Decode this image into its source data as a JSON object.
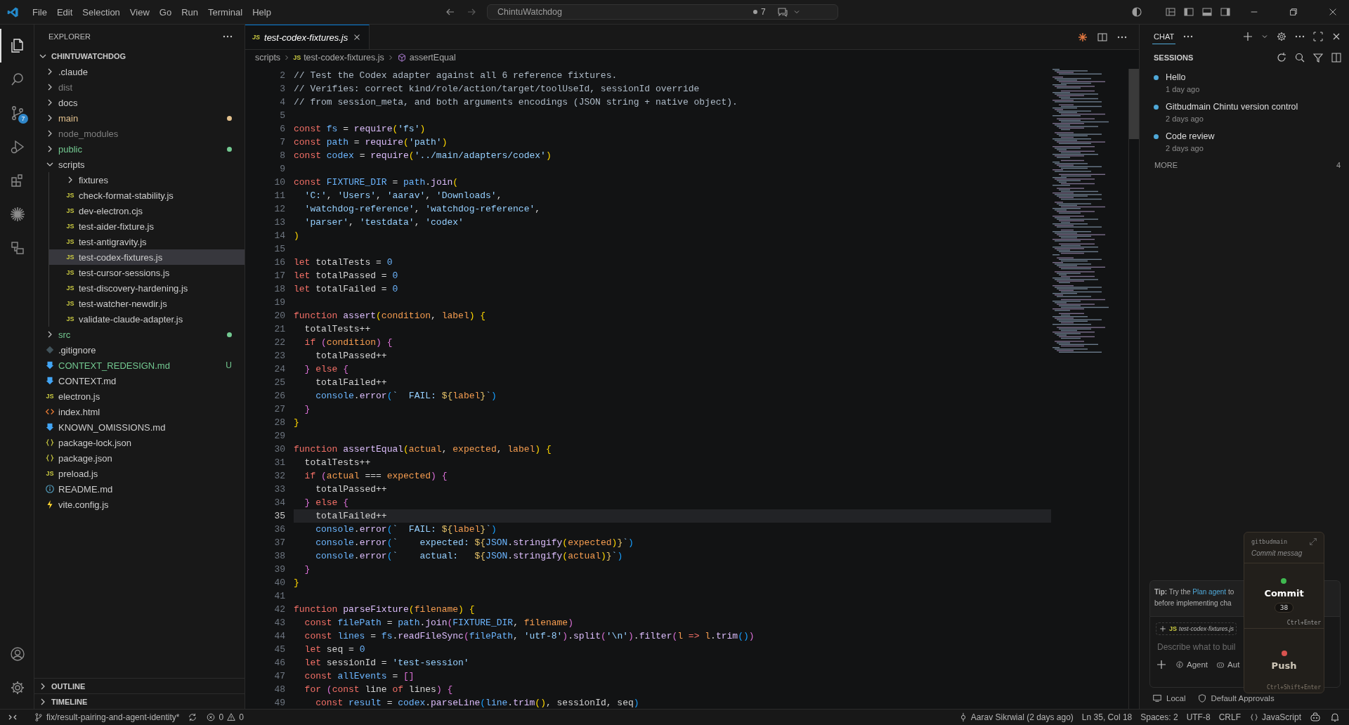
{
  "title_bar": {
    "menus": [
      "File",
      "Edit",
      "Selection",
      "View",
      "Go",
      "Run",
      "Terminal",
      "Help"
    ],
    "command_center": "ChintuWatchdog",
    "agent_count": "7"
  },
  "activity_bar": {
    "items": [
      {
        "kind": "files",
        "selected": true
      },
      {
        "kind": "search",
        "selected": false
      },
      {
        "kind": "source-control",
        "selected": false,
        "badge": "7"
      },
      {
        "kind": "run",
        "selected": false
      },
      {
        "kind": "extensions",
        "selected": false
      },
      {
        "kind": "burst",
        "selected": false
      },
      {
        "kind": "remote",
        "selected": false
      }
    ],
    "bottom": [
      {
        "kind": "account"
      },
      {
        "kind": "settings"
      }
    ]
  },
  "explorer": {
    "title": "EXPLORER",
    "root": "CHINTUWATCHDOG",
    "root_expanded": true,
    "items": [
      {
        "name": ".claude",
        "kind": "folder",
        "expanded": false,
        "selected": false
      },
      {
        "name": "dist",
        "kind": "folder",
        "expanded": false,
        "selected": false,
        "dimmed": true
      },
      {
        "name": "docs",
        "kind": "folder",
        "expanded": false,
        "selected": false
      },
      {
        "name": "main",
        "kind": "folder",
        "expanded": false,
        "selected": false,
        "color": "#e2c08d"
      },
      {
        "name": "node_modules",
        "kind": "folder",
        "expanded": false,
        "selected": false,
        "dimmed": true
      },
      {
        "name": "public",
        "kind": "folder",
        "expanded": false,
        "selected": false,
        "color": "#73c991"
      },
      {
        "name": "scripts",
        "kind": "folder",
        "expanded": true,
        "selected": false,
        "children": [
          {
            "name": "fixtures",
            "kind": "folder",
            "expanded": false,
            "selected": false
          },
          {
            "name": "check-format-stability.js",
            "kind": "js",
            "icon_label": "JS",
            "selected": false
          },
          {
            "name": "dev-electron.cjs",
            "kind": "js",
            "icon_label": "JS",
            "selected": false
          },
          {
            "name": "test-aider-fixture.js",
            "kind": "js",
            "icon_label": "JS",
            "selected": false
          },
          {
            "name": "test-antigravity.js",
            "kind": "js",
            "icon_label": "JS",
            "selected": false
          },
          {
            "name": "test-codex-fixtures.js",
            "kind": "js",
            "icon_label": "JS",
            "selected": true
          },
          {
            "name": "test-cursor-sessions.js",
            "kind": "js",
            "icon_label": "JS",
            "selected": false
          },
          {
            "name": "test-discovery-hardening.js",
            "kind": "js",
            "icon_label": "JS",
            "selected": false
          },
          {
            "name": "test-watcher-newdir.js",
            "kind": "js",
            "icon_label": "JS",
            "selected": false
          },
          {
            "name": "validate-claude-adapter.js",
            "kind": "js",
            "icon_label": "JS",
            "selected": false
          }
        ]
      },
      {
        "name": "src",
        "kind": "folder",
        "expanded": false,
        "selected": false,
        "color": "#73c991"
      },
      {
        "name": ".gitignore",
        "kind": "git",
        "selected": false
      },
      {
        "name": "CONTEXT_REDESIGN.md",
        "kind": "md",
        "selected": false,
        "color": "#73c991",
        "badge": "U"
      },
      {
        "name": "CONTEXT.md",
        "kind": "md",
        "selected": false
      },
      {
        "name": "electron.js",
        "kind": "js",
        "icon_label": "JS",
        "selected": false
      },
      {
        "name": "index.html",
        "kind": "html",
        "selected": false
      },
      {
        "name": "KNOWN_OMISSIONS.md",
        "kind": "md",
        "selected": false
      },
      {
        "name": "package-lock.json",
        "kind": "json",
        "selected": false
      },
      {
        "name": "package.json",
        "kind": "json",
        "selected": false
      },
      {
        "name": "preload.js",
        "kind": "js",
        "icon_label": "JS",
        "selected": false
      },
      {
        "name": "README.md",
        "kind": "info",
        "selected": false
      },
      {
        "name": "vite.config.js",
        "kind": "vite",
        "selected": false
      }
    ],
    "sections": [
      {
        "label": "OUTLINE",
        "expanded": false
      },
      {
        "label": "TIMELINE",
        "expanded": false
      }
    ]
  },
  "editor": {
    "tabs": [
      {
        "label": "test-codex-fixtures.js",
        "icon_label": "JS",
        "selected": true,
        "preview": true
      }
    ],
    "breadcrumbs": [
      {
        "text": "scripts"
      },
      {
        "text": "test-codex-fixtures.js",
        "icon_label": "JS"
      },
      {
        "text": "assertEqual",
        "kind": "symbol"
      }
    ],
    "lines": [
      {
        "number": "2",
        "current": false,
        "tokens": [
          {
            "kind": "cm",
            "text": "// Test the Codex adapter against all 6 reference fixtures."
          }
        ]
      },
      {
        "number": "3",
        "current": false,
        "tokens": [
          {
            "kind": "cm",
            "text": "// Verifies: correct kind/role/action/target/toolUseId, sessionId override"
          }
        ]
      },
      {
        "number": "4",
        "current": false,
        "tokens": [
          {
            "kind": "cm",
            "text": "// from session_meta, and both arguments encodings (JSON string + native object)."
          }
        ]
      },
      {
        "number": "5",
        "current": false
      },
      {
        "number": "6",
        "current": false,
        "tokens": [
          {
            "kind": "kw",
            "text": "const"
          },
          {
            "kind": "var",
            "text": " fs"
          },
          {
            "kind": "pl",
            "text": " = "
          },
          {
            "kind": "fn",
            "text": "require"
          },
          {
            "kind": "b1",
            "text": "("
          },
          {
            "kind": "str",
            "text": "'fs'"
          },
          {
            "kind": "b1",
            "text": ")"
          }
        ]
      },
      {
        "number": "7",
        "current": false,
        "tokens": [
          {
            "kind": "kw",
            "text": "const"
          },
          {
            "kind": "var",
            "text": " path"
          },
          {
            "kind": "pl",
            "text": " = "
          },
          {
            "kind": "fn",
            "text": "require"
          },
          {
            "kind": "b1",
            "text": "("
          },
          {
            "kind": "str",
            "text": "'path'"
          },
          {
            "kind": "b1",
            "text": ")"
          }
        ]
      },
      {
        "number": "8",
        "current": false,
        "tokens": [
          {
            "kind": "kw",
            "text": "const"
          },
          {
            "kind": "var",
            "text": " codex"
          },
          {
            "kind": "pl",
            "text": " = "
          },
          {
            "kind": "fn",
            "text": "require"
          },
          {
            "kind": "b1",
            "text": "("
          },
          {
            "kind": "str",
            "text": "'../main/adapters/codex'"
          },
          {
            "kind": "b1",
            "text": ")"
          }
        ]
      },
      {
        "number": "9",
        "current": false
      },
      {
        "number": "10",
        "current": false,
        "tokens": [
          {
            "kind": "kw",
            "text": "const"
          },
          {
            "kind": "var",
            "text": " FIXTURE_DIR"
          },
          {
            "kind": "pl",
            "text": " = "
          },
          {
            "kind": "var",
            "text": "path"
          },
          {
            "kind": "pl",
            "text": "."
          },
          {
            "kind": "fn",
            "text": "join"
          },
          {
            "kind": "b1",
            "text": "("
          }
        ]
      },
      {
        "number": "11",
        "current": false,
        "tokens": [
          {
            "kind": "str",
            "text": "  'C:'"
          },
          {
            "kind": "pl",
            "text": ", "
          },
          {
            "kind": "str",
            "text": "'Users'"
          },
          {
            "kind": "pl",
            "text": ", "
          },
          {
            "kind": "str",
            "text": "'aarav'"
          },
          {
            "kind": "pl",
            "text": ", "
          },
          {
            "kind": "str",
            "text": "'Downloads'"
          },
          {
            "kind": "pl",
            "text": ","
          }
        ]
      },
      {
        "number": "12",
        "current": false,
        "tokens": [
          {
            "kind": "str",
            "text": "  'watchdog-reference'"
          },
          {
            "kind": "pl",
            "text": ", "
          },
          {
            "kind": "str",
            "text": "'watchdog-reference'"
          },
          {
            "kind": "pl",
            "text": ","
          }
        ]
      },
      {
        "number": "13",
        "current": false,
        "tokens": [
          {
            "kind": "str",
            "text": "  'parser'"
          },
          {
            "kind": "pl",
            "text": ", "
          },
          {
            "kind": "str",
            "text": "'testdata'"
          },
          {
            "kind": "pl",
            "text": ", "
          },
          {
            "kind": "str",
            "text": "'codex'"
          }
        ]
      },
      {
        "number": "14",
        "current": false,
        "tokens": [
          {
            "kind": "b1",
            "text": ")"
          }
        ]
      },
      {
        "number": "15",
        "current": false
      },
      {
        "number": "16",
        "current": false,
        "tokens": [
          {
            "kind": "kw",
            "text": "let"
          },
          {
            "kind": "pl",
            "text": " totalTests = "
          },
          {
            "kind": "num",
            "text": "0"
          }
        ]
      },
      {
        "number": "17",
        "current": false,
        "tokens": [
          {
            "kind": "kw",
            "text": "let"
          },
          {
            "kind": "pl",
            "text": " totalPassed = "
          },
          {
            "kind": "num",
            "text": "0"
          }
        ]
      },
      {
        "number": "18",
        "current": false,
        "tokens": [
          {
            "kind": "kw",
            "text": "let"
          },
          {
            "kind": "pl",
            "text": " totalFailed = "
          },
          {
            "kind": "num",
            "text": "0"
          }
        ]
      },
      {
        "number": "19",
        "current": false
      },
      {
        "number": "20",
        "current": false,
        "tokens": [
          {
            "kind": "kw",
            "text": "function"
          },
          {
            "kind": "fn",
            "text": " assert"
          },
          {
            "kind": "b1",
            "text": "("
          },
          {
            "kind": "prm",
            "text": "condition"
          },
          {
            "kind": "pl",
            "text": ", "
          },
          {
            "kind": "prm",
            "text": "label"
          },
          {
            "kind": "b1",
            "text": ")"
          },
          {
            "kind": "b1",
            "text": " {"
          }
        ]
      },
      {
        "number": "21",
        "current": false,
        "tokens": [
          {
            "kind": "pl",
            "text": "  totalTests++"
          }
        ]
      },
      {
        "number": "22",
        "current": false,
        "tokens": [
          {
            "kind": "kw",
            "text": "  if"
          },
          {
            "kind": "b2",
            "text": " ("
          },
          {
            "kind": "prm",
            "text": "condition"
          },
          {
            "kind": "b2",
            "text": ")"
          },
          {
            "kind": "b2",
            "text": " {"
          }
        ]
      },
      {
        "number": "23",
        "current": false,
        "tokens": [
          {
            "kind": "pl",
            "text": "    totalPassed++"
          }
        ]
      },
      {
        "number": "24",
        "current": false,
        "tokens": [
          {
            "kind": "b2",
            "text": "  }"
          },
          {
            "kind": "kw",
            "text": " else"
          },
          {
            "kind": "b2",
            "text": " {"
          }
        ]
      },
      {
        "number": "25",
        "current": false,
        "tokens": [
          {
            "kind": "pl",
            "text": "    totalFailed++"
          }
        ]
      },
      {
        "number": "26",
        "current": false,
        "tokens": [
          {
            "kind": "var",
            "text": "    console"
          },
          {
            "kind": "pl",
            "text": "."
          },
          {
            "kind": "fn",
            "text": "error"
          },
          {
            "kind": "b3",
            "text": "("
          },
          {
            "kind": "str",
            "text": "`  FAIL: "
          },
          {
            "kind": "tpl",
            "text": "${"
          },
          {
            "kind": "prm",
            "text": "label"
          },
          {
            "kind": "tpl",
            "text": "}"
          },
          {
            "kind": "str",
            "text": "`"
          },
          {
            "kind": "b3",
            "text": ")"
          }
        ]
      },
      {
        "number": "27",
        "current": false,
        "tokens": [
          {
            "kind": "b2",
            "text": "  }"
          }
        ]
      },
      {
        "number": "28",
        "current": false,
        "tokens": [
          {
            "kind": "b1",
            "text": "}"
          }
        ]
      },
      {
        "number": "29",
        "current": false
      },
      {
        "number": "30",
        "current": false,
        "tokens": [
          {
            "kind": "kw",
            "text": "function"
          },
          {
            "kind": "fn",
            "text": " assertEqual"
          },
          {
            "kind": "b1",
            "text": "("
          },
          {
            "kind": "prm",
            "text": "actual"
          },
          {
            "kind": "pl",
            "text": ", "
          },
          {
            "kind": "prm",
            "text": "expected"
          },
          {
            "kind": "pl",
            "text": ", "
          },
          {
            "kind": "prm",
            "text": "label"
          },
          {
            "kind": "b1",
            "text": ")"
          },
          {
            "kind": "b1",
            "text": " {"
          }
        ]
      },
      {
        "number": "31",
        "current": false,
        "tokens": [
          {
            "kind": "pl",
            "text": "  totalTests++"
          }
        ]
      },
      {
        "number": "32",
        "current": false,
        "tokens": [
          {
            "kind": "kw",
            "text": "  if"
          },
          {
            "kind": "b2",
            "text": " ("
          },
          {
            "kind": "prm",
            "text": "actual"
          },
          {
            "kind": "pl",
            "text": " === "
          },
          {
            "kind": "prm",
            "text": "expected"
          },
          {
            "kind": "b2",
            "text": ")"
          },
          {
            "kind": "b2",
            "text": " {"
          }
        ]
      },
      {
        "number": "33",
        "current": false,
        "tokens": [
          {
            "kind": "pl",
            "text": "    totalPassed++"
          }
        ]
      },
      {
        "number": "34",
        "current": false,
        "tokens": [
          {
            "kind": "b2",
            "text": "  }"
          },
          {
            "kind": "kw",
            "text": " else"
          },
          {
            "kind": "b2",
            "text": " {"
          }
        ]
      },
      {
        "number": "35",
        "current": true,
        "tokens": [
          {
            "kind": "pl",
            "text": "    totalFailed++"
          }
        ]
      },
      {
        "number": "36",
        "current": false,
        "tokens": [
          {
            "kind": "var",
            "text": "    console"
          },
          {
            "kind": "pl",
            "text": "."
          },
          {
            "kind": "fn",
            "text": "error"
          },
          {
            "kind": "b3",
            "text": "("
          },
          {
            "kind": "str",
            "text": "`  FAIL: "
          },
          {
            "kind": "tpl",
            "text": "${"
          },
          {
            "kind": "prm",
            "text": "label"
          },
          {
            "kind": "tpl",
            "text": "}"
          },
          {
            "kind": "str",
            "text": "`"
          },
          {
            "kind": "b3",
            "text": ")"
          }
        ]
      },
      {
        "number": "37",
        "current": false,
        "tokens": [
          {
            "kind": "var",
            "text": "    console"
          },
          {
            "kind": "pl",
            "text": "."
          },
          {
            "kind": "fn",
            "text": "error"
          },
          {
            "kind": "b3",
            "text": "("
          },
          {
            "kind": "str",
            "text": "`    expected: "
          },
          {
            "kind": "tpl",
            "text": "${"
          },
          {
            "kind": "var",
            "text": "JSON"
          },
          {
            "kind": "pl",
            "text": "."
          },
          {
            "kind": "fn",
            "text": "stringify"
          },
          {
            "kind": "b1",
            "text": "("
          },
          {
            "kind": "prm",
            "text": "expected"
          },
          {
            "kind": "b1",
            "text": ")"
          },
          {
            "kind": "tpl",
            "text": "}"
          },
          {
            "kind": "str",
            "text": "`"
          },
          {
            "kind": "b3",
            "text": ")"
          }
        ]
      },
      {
        "number": "38",
        "current": false,
        "tokens": [
          {
            "kind": "var",
            "text": "    console"
          },
          {
            "kind": "pl",
            "text": "."
          },
          {
            "kind": "fn",
            "text": "error"
          },
          {
            "kind": "b3",
            "text": "("
          },
          {
            "kind": "str",
            "text": "`    actual:   "
          },
          {
            "kind": "tpl",
            "text": "${"
          },
          {
            "kind": "var",
            "text": "JSON"
          },
          {
            "kind": "pl",
            "text": "."
          },
          {
            "kind": "fn",
            "text": "stringify"
          },
          {
            "kind": "b1",
            "text": "("
          },
          {
            "kind": "prm",
            "text": "actual"
          },
          {
            "kind": "b1",
            "text": ")"
          },
          {
            "kind": "tpl",
            "text": "}"
          },
          {
            "kind": "str",
            "text": "`"
          },
          {
            "kind": "b3",
            "text": ")"
          }
        ]
      },
      {
        "number": "39",
        "current": false,
        "tokens": [
          {
            "kind": "b2",
            "text": "  }"
          }
        ]
      },
      {
        "number": "40",
        "current": false,
        "tokens": [
          {
            "kind": "b1",
            "text": "}"
          }
        ]
      },
      {
        "number": "41",
        "current": false
      },
      {
        "number": "42",
        "current": false,
        "tokens": [
          {
            "kind": "kw",
            "text": "function"
          },
          {
            "kind": "fn",
            "text": " parseFixture"
          },
          {
            "kind": "b1",
            "text": "("
          },
          {
            "kind": "prm",
            "text": "filename"
          },
          {
            "kind": "b1",
            "text": ")"
          },
          {
            "kind": "b1",
            "text": " {"
          }
        ]
      },
      {
        "number": "43",
        "current": false,
        "tokens": [
          {
            "kind": "kw",
            "text": "  const"
          },
          {
            "kind": "var",
            "text": " filePath"
          },
          {
            "kind": "pl",
            "text": " = "
          },
          {
            "kind": "var",
            "text": "path"
          },
          {
            "kind": "pl",
            "text": "."
          },
          {
            "kind": "fn",
            "text": "join"
          },
          {
            "kind": "b2",
            "text": "("
          },
          {
            "kind": "var",
            "text": "FIXTURE_DIR"
          },
          {
            "kind": "pl",
            "text": ", "
          },
          {
            "kind": "prm",
            "text": "filename"
          },
          {
            "kind": "b2",
            "text": ")"
          }
        ]
      },
      {
        "number": "44",
        "current": false,
        "tokens": [
          {
            "kind": "kw",
            "text": "  const"
          },
          {
            "kind": "var",
            "text": " lines"
          },
          {
            "kind": "pl",
            "text": " = "
          },
          {
            "kind": "var",
            "text": "fs"
          },
          {
            "kind": "pl",
            "text": "."
          },
          {
            "kind": "fn",
            "text": "readFileSync"
          },
          {
            "kind": "b2",
            "text": "("
          },
          {
            "kind": "var",
            "text": "filePath"
          },
          {
            "kind": "pl",
            "text": ", "
          },
          {
            "kind": "str",
            "text": "'utf-8'"
          },
          {
            "kind": "b2",
            "text": ")"
          },
          {
            "kind": "pl",
            "text": "."
          },
          {
            "kind": "fn",
            "text": "split"
          },
          {
            "kind": "b2",
            "text": "("
          },
          {
            "kind": "str",
            "text": "'\\n'"
          },
          {
            "kind": "b2",
            "text": ")"
          },
          {
            "kind": "pl",
            "text": "."
          },
          {
            "kind": "fn",
            "text": "filter"
          },
          {
            "kind": "b2",
            "text": "("
          },
          {
            "kind": "prm",
            "text": "l"
          },
          {
            "kind": "kw",
            "text": " => "
          },
          {
            "kind": "prm",
            "text": "l"
          },
          {
            "kind": "pl",
            "text": "."
          },
          {
            "kind": "fn",
            "text": "trim"
          },
          {
            "kind": "b3",
            "text": "()"
          },
          {
            "kind": "b2",
            "text": ")"
          }
        ]
      },
      {
        "number": "45",
        "current": false,
        "tokens": [
          {
            "kind": "kw",
            "text": "  let"
          },
          {
            "kind": "pl",
            "text": " seq = "
          },
          {
            "kind": "num",
            "text": "0"
          }
        ]
      },
      {
        "number": "46",
        "current": false,
        "tokens": [
          {
            "kind": "kw",
            "text": "  let"
          },
          {
            "kind": "pl",
            "text": " sessionId = "
          },
          {
            "kind": "str",
            "text": "'test-session'"
          }
        ]
      },
      {
        "number": "47",
        "current": false,
        "tokens": [
          {
            "kind": "kw",
            "text": "  const"
          },
          {
            "kind": "var",
            "text": " allEvents"
          },
          {
            "kind": "pl",
            "text": " = "
          },
          {
            "kind": "b2",
            "text": "[]"
          }
        ]
      },
      {
        "number": "48",
        "current": false,
        "tokens": [
          {
            "kind": "kw",
            "text": "  for"
          },
          {
            "kind": "b2",
            "text": " ("
          },
          {
            "kind": "kw",
            "text": "const"
          },
          {
            "kind": "pl",
            "text": " line "
          },
          {
            "kind": "kw",
            "text": "of"
          },
          {
            "kind": "pl",
            "text": " lines"
          },
          {
            "kind": "b2",
            "text": ")"
          },
          {
            "kind": "b2",
            "text": " {"
          }
        ]
      },
      {
        "number": "49",
        "current": false,
        "tokens": [
          {
            "kind": "kw",
            "text": "    const"
          },
          {
            "kind": "var",
            "text": " result"
          },
          {
            "kind": "pl",
            "text": " = "
          },
          {
            "kind": "var",
            "text": "codex"
          },
          {
            "kind": "pl",
            "text": "."
          },
          {
            "kind": "fn",
            "text": "parseLine"
          },
          {
            "kind": "b3",
            "text": "("
          },
          {
            "kind": "var",
            "text": "line"
          },
          {
            "kind": "pl",
            "text": "."
          },
          {
            "kind": "fn",
            "text": "trim"
          },
          {
            "kind": "b1",
            "text": "()"
          },
          {
            "kind": "pl",
            "text": ", sessionId, seq"
          },
          {
            "kind": "b3",
            "text": ")"
          }
        ]
      }
    ]
  },
  "chat": {
    "tabs": [
      {
        "label": "CHAT",
        "selected": true
      }
    ],
    "sessions_title": "SESSIONS",
    "sessions": [
      {
        "title": "Hello",
        "time": "1 day ago",
        "color": "#4fa8d8"
      },
      {
        "title": "Gitbudmain Chintu version control",
        "time": "2 days ago",
        "color": "#4fa8d8"
      },
      {
        "title": "Code review",
        "time": "2 days ago",
        "color": "#4fa8d8"
      }
    ],
    "more_label": "MORE",
    "more_count": "4",
    "tip": {
      "lead": "**Tip:** Try the ",
      "link": "Plan agent",
      "rest": " to",
      "line2": "before implementing cha"
    },
    "attachment": {
      "icon_label": "JS",
      "name": "test-codex-fixtures.js"
    },
    "input_placeholder": "Describe what to buil",
    "mode": "Agent",
    "model": "Aut",
    "footer": [
      {
        "kind": "monitor",
        "label": "Local"
      },
      {
        "kind": "shield",
        "label": "Default Approvals"
      }
    ]
  },
  "git_popup": {
    "branch": "gitbudmain",
    "message_placeholder": "Commit messag",
    "actions": [
      {
        "label": "Commit",
        "color": "#3fb950",
        "count": "38",
        "shortcut": "Ctrl+Enter"
      },
      {
        "label": "Push",
        "color": "#d9534f",
        "shortcut": "Ctrl+Shift+Enter"
      }
    ]
  },
  "status_bar": {
    "branch": "fix/result-pairing-and-agent-identity*",
    "errors": "0",
    "warnings": "0",
    "blame": "Aarav Sikrwial (2 days ago)",
    "position": "Ln 35, Col 18",
    "indent": "Spaces: 2",
    "encoding": "UTF-8",
    "eol": "CRLF",
    "language": "JavaScript"
  }
}
